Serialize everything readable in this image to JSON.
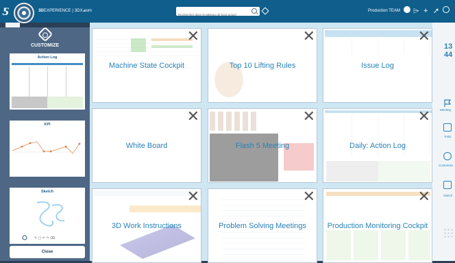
{
  "topbar": {
    "brand_bold": "3D",
    "brand_rest": "EXPERIENCE | 3DX.com",
    "search_placeholder": "Rechercher dans le tableau de bord actuel",
    "team_label": "Production TEAM"
  },
  "customize": {
    "title": "CUSTOMIZE",
    "thumbnails": [
      {
        "label": "Action Log"
      },
      {
        "label": "KPI"
      },
      {
        "label": "Sketch"
      }
    ],
    "close_label": "Close"
  },
  "tiles": [
    {
      "label": "Machine State Cockpit"
    },
    {
      "label": "Top 10 Lifting Rules"
    },
    {
      "label": "Issue Log"
    },
    {
      "label": "White Board"
    },
    {
      "label": "Flash 5 Meeting"
    },
    {
      "label": "Daily: Action Log"
    },
    {
      "label": "3D Work Instructions"
    },
    {
      "label": "Problem Solving Meetings"
    },
    {
      "label": "Production Monitoring Cockpit"
    }
  ],
  "right_rail": {
    "number_1": "13",
    "number_2": "44",
    "items": [
      {
        "label": "Meeting",
        "icon": "flag-icon"
      },
      {
        "label": "Tools",
        "icon": "edit-icon"
      },
      {
        "label": "Customize",
        "icon": "gear-icon"
      },
      {
        "label": "Switch",
        "icon": "switch-icon"
      }
    ]
  },
  "colors": {
    "topbar": "#0f5e8c",
    "panel": "#4e6785",
    "accent": "#2a82b6",
    "grid_bg": "#cfe6f3"
  }
}
